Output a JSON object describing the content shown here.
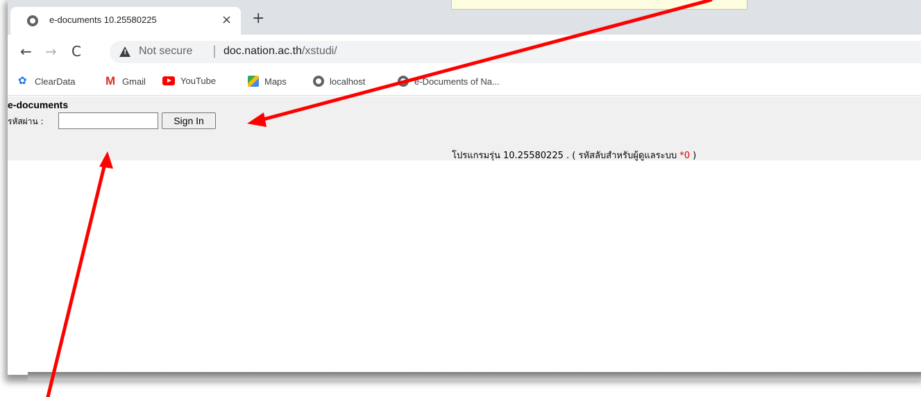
{
  "browser": {
    "tab": {
      "title": "e-documents 10.25580225",
      "close_glyph": "×"
    },
    "new_tab_glyph": "+",
    "nav": {
      "back": "←",
      "forward": "→",
      "reload": "C"
    },
    "omnibox": {
      "security_label": "Not secure",
      "separator": "|",
      "host": "doc.nation.ac.th",
      "path": "/xstudi/"
    },
    "bookmarks": [
      {
        "label": "ClearData",
        "icon": "gear-icon"
      },
      {
        "label": "Gmail",
        "icon": "gmail-icon"
      },
      {
        "label": "YouTube",
        "icon": "youtube-icon"
      },
      {
        "label": "Maps",
        "icon": "maps-icon"
      },
      {
        "label": "localhost",
        "icon": "globe-icon"
      },
      {
        "label": "e-Documents of Na...",
        "icon": "globe-icon"
      }
    ]
  },
  "page": {
    "app_title": "e-documents",
    "password_label": "รหัสผ่าน :",
    "password_value": "",
    "signin_label": "Sign In",
    "version_prefix": "โปรแกรมรุ่น 10.25580225 . ( รหัสลับสำหรับผู้ดูแลระบบ ",
    "admin_code": "*0",
    "version_suffix": " )"
  },
  "colors": {
    "annotation_arrow": "#ff0000",
    "page_background": "#f0f0f0",
    "admin_code": "#e00000"
  }
}
